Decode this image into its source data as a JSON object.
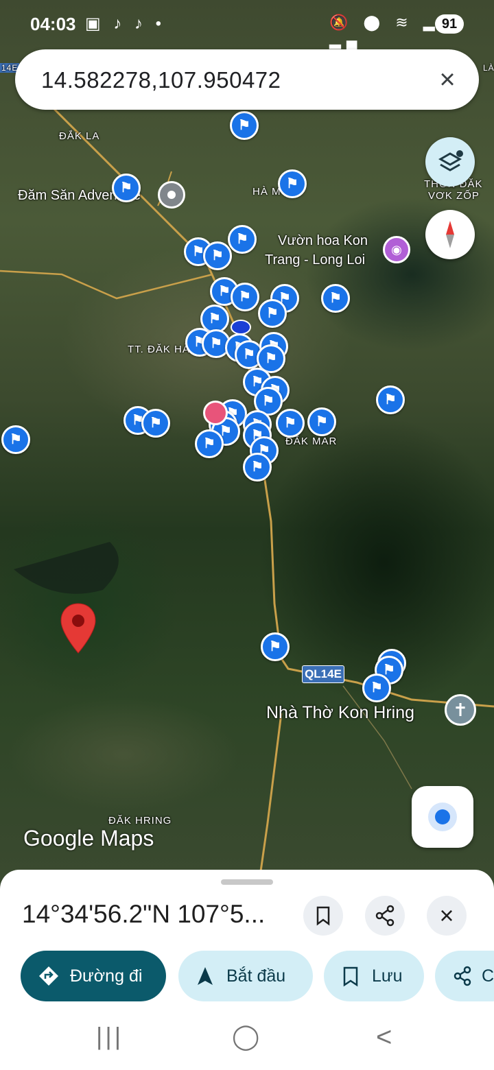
{
  "status_bar": {
    "time": "04:03",
    "left_icons": "▣ ♪ ♪ •",
    "right_icons": "🔕 ⬤ ≋ ▂▄ ▂▄",
    "battery": "91"
  },
  "search": {
    "query": "14.582278,107.950472",
    "clear_icon": "×"
  },
  "map_labels": {
    "dak_la": "ĐẮK LA",
    "dam_san": "Đăm Săn Adventure",
    "ha_mon": "HÀ M",
    "vuon_hoa": "Vườn hoa Kon",
    "vuon_hoa_2": "Trang - Long Loi",
    "tt_dak_ha": "TT. ĐĂK HÀ",
    "dak_mar": "ĐẮK MAR",
    "thon_dak": "THÔN ĐĂK",
    "vok_zop": "VƠK ZỐP",
    "nha_tho": "Nhà Thờ Kon Hring",
    "dak_hring": "ĐĂK HRING",
    "road_ql14e": "QL14E",
    "edge_left": "14E",
    "edge_right": "LÀ"
  },
  "google_maps_logo": "Google Maps",
  "sheet": {
    "coords": "14°34'56.2\"N 107°5...",
    "save_icon": "⌑",
    "share_icon": "⋖",
    "close_icon": "×",
    "chips": {
      "directions": "Đường đi",
      "start": "Bắt đầu",
      "save": "Lưu",
      "share": "C"
    }
  },
  "nav": {
    "recent": "|||",
    "home": "◯",
    "back": "<"
  },
  "colors": {
    "accent": "#0b5a6b",
    "chip_light": "#d3eef6",
    "pin_blue": "#1a73e8",
    "marker_red": "#e53935"
  }
}
